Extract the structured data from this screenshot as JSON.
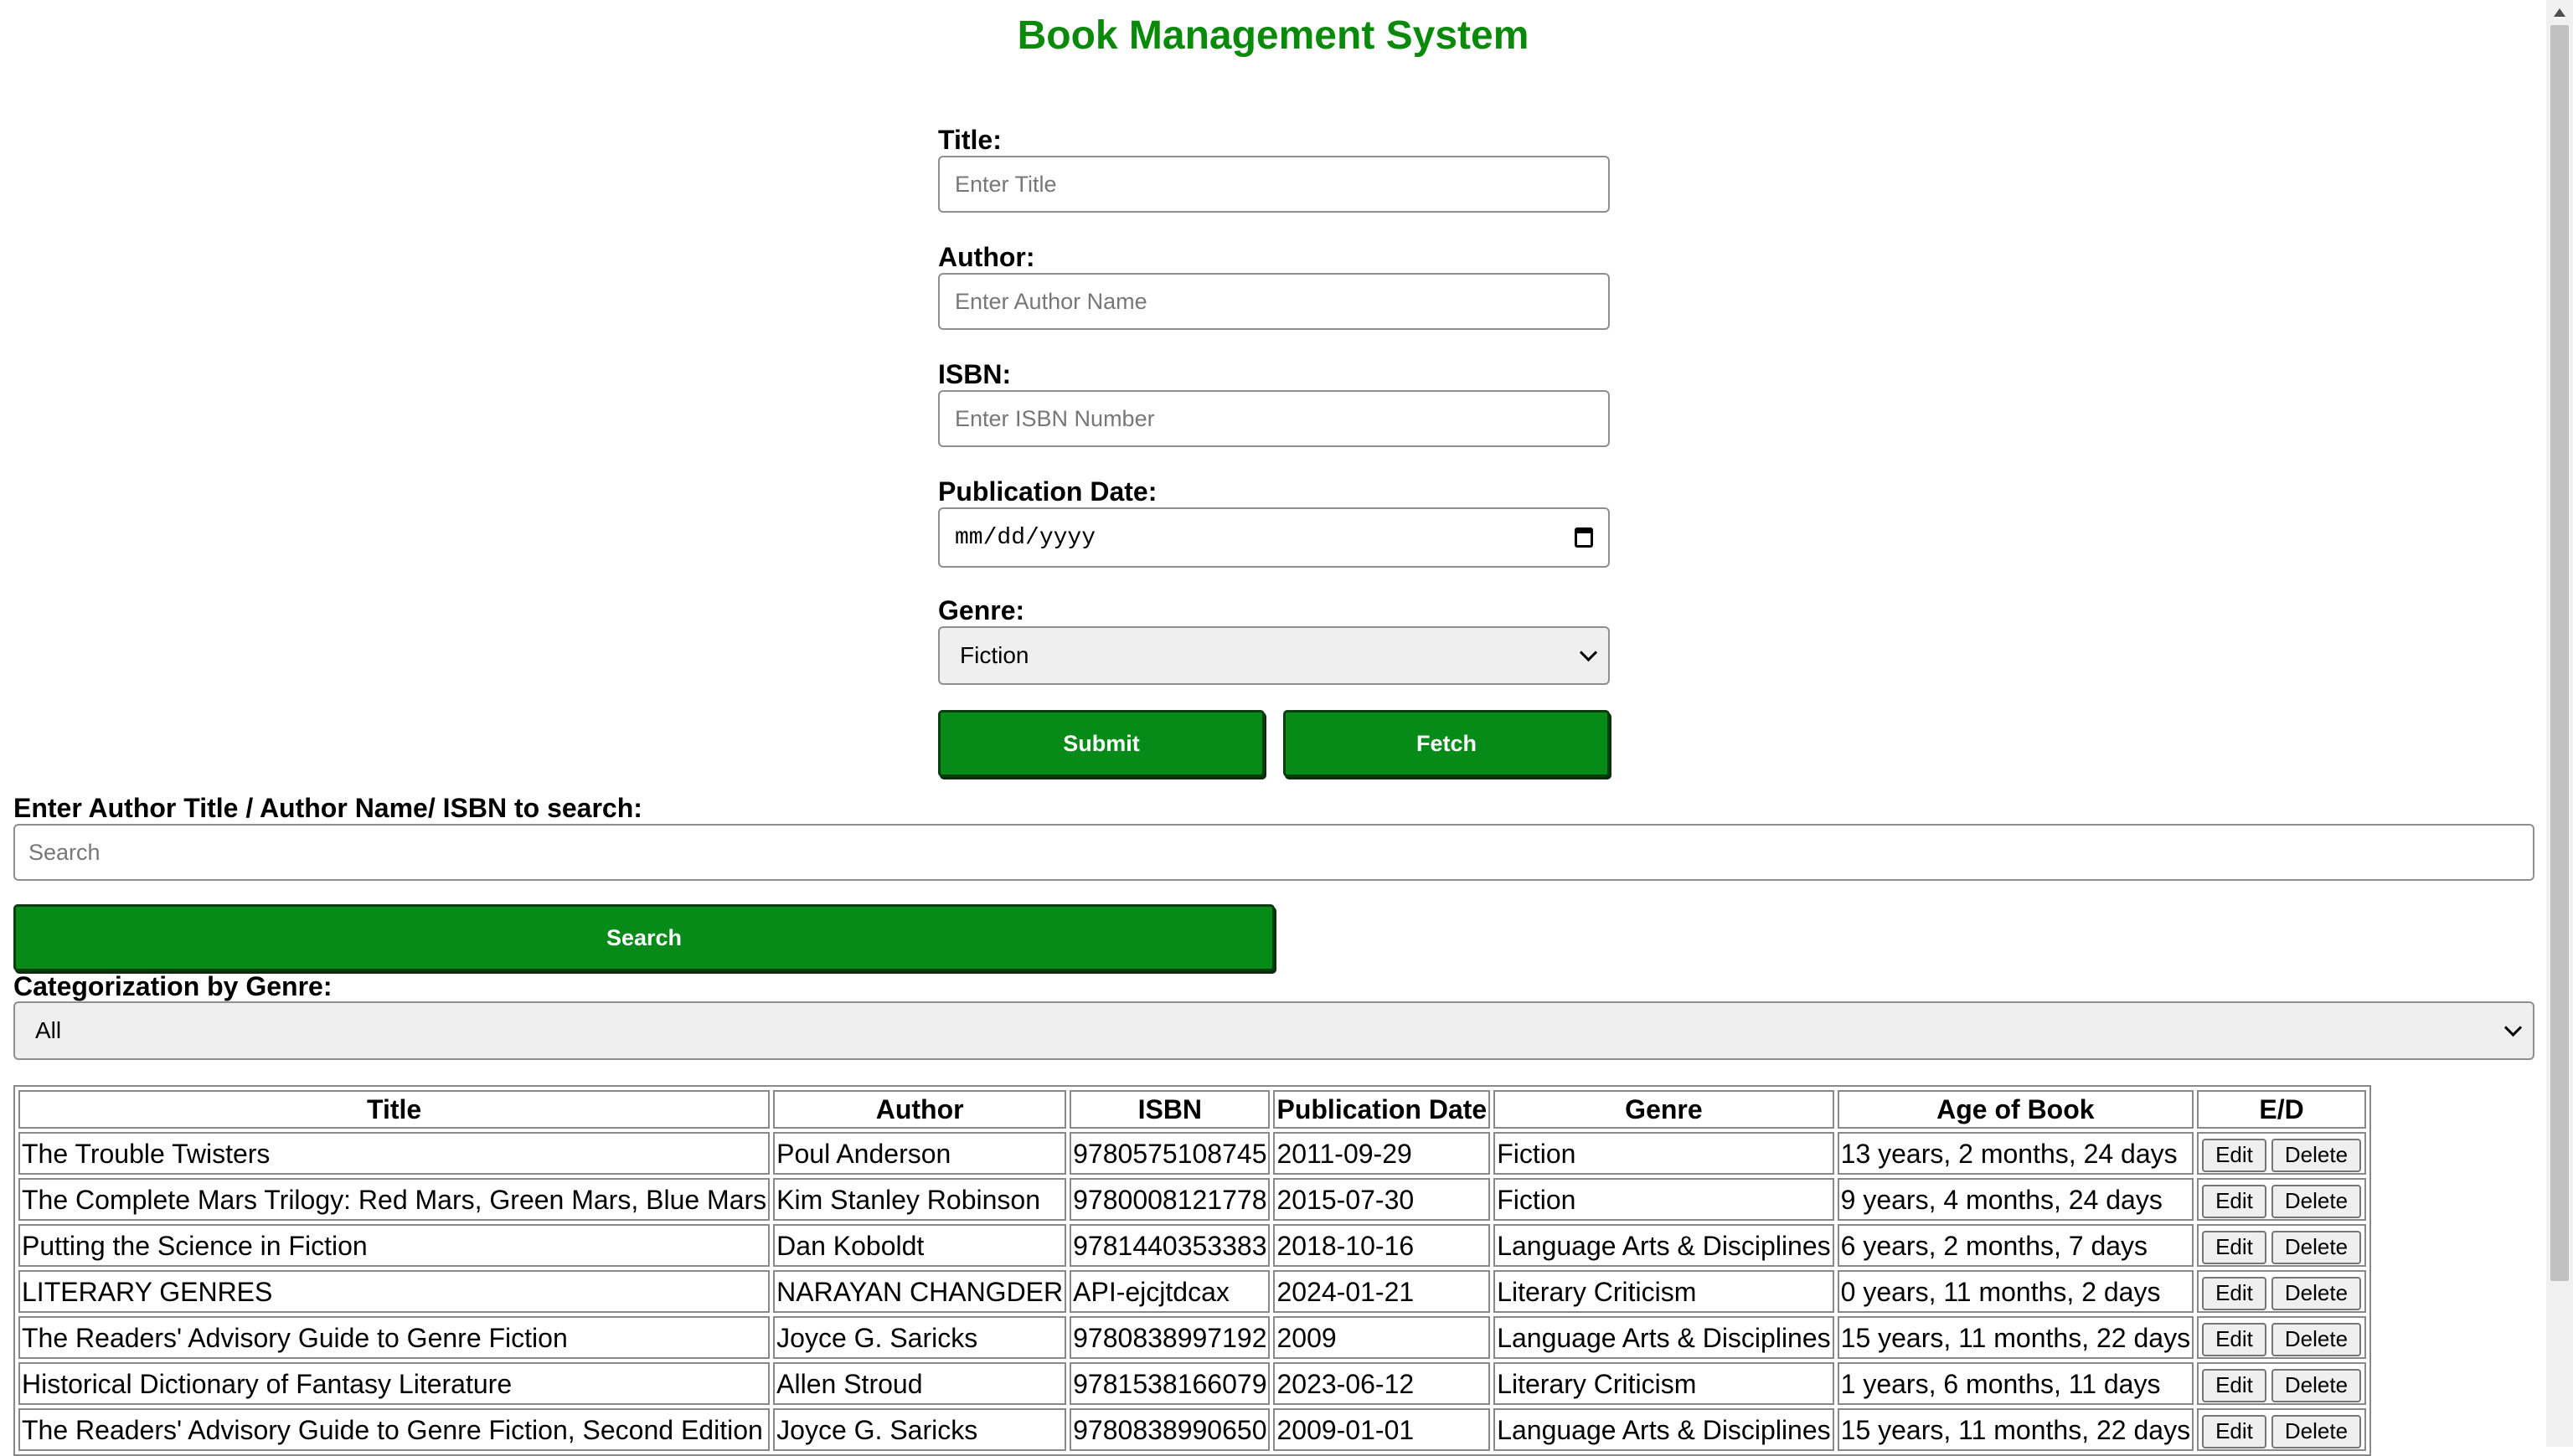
{
  "app": {
    "title": "Book Management System"
  },
  "form": {
    "title_label": "Title:",
    "title_placeholder": "Enter Title",
    "author_label": "Author:",
    "author_placeholder": "Enter Author Name",
    "isbn_label": "ISBN:",
    "isbn_placeholder": "Enter ISBN Number",
    "date_label": "Publication Date:",
    "date_placeholder": "mm/dd/yyyy",
    "genre_label": "Genre:",
    "genre_selected": "Fiction",
    "submit_label": "Submit",
    "fetch_label": "Fetch"
  },
  "search": {
    "label": "Enter Author Title / Author Name/ ISBN to search:",
    "placeholder": "Search",
    "button_label": "Search"
  },
  "filter": {
    "label": "Categorization by Genre:",
    "selected": "All"
  },
  "table": {
    "headers": [
      "Title",
      "Author",
      "ISBN",
      "Publication Date",
      "Genre",
      "Age of Book",
      "E/D"
    ],
    "edit_label": "Edit",
    "delete_label": "Delete",
    "rows": [
      {
        "title": "The Trouble Twisters",
        "author": "Poul Anderson",
        "isbn": "9780575108745",
        "date": "2011-09-29",
        "genre": "Fiction",
        "age": "13 years, 2 months, 24 days"
      },
      {
        "title": "The Complete Mars Trilogy: Red Mars, Green Mars, Blue Mars",
        "author": "Kim Stanley Robinson",
        "isbn": "9780008121778",
        "date": "2015-07-30",
        "genre": "Fiction",
        "age": "9 years, 4 months, 24 days"
      },
      {
        "title": "Putting the Science in Fiction",
        "author": "Dan Koboldt",
        "isbn": "9781440353383",
        "date": "2018-10-16",
        "genre": "Language Arts & Disciplines",
        "age": "6 years, 2 months, 7 days"
      },
      {
        "title": "LITERARY GENRES",
        "author": "NARAYAN CHANGDER",
        "isbn": "API-ejcjtdcax",
        "date": "2024-01-21",
        "genre": "Literary Criticism",
        "age": "0 years, 11 months, 2 days"
      },
      {
        "title": "The Readers' Advisory Guide to Genre Fiction",
        "author": "Joyce G. Saricks",
        "isbn": "9780838997192",
        "date": "2009",
        "genre": "Language Arts & Disciplines",
        "age": "15 years, 11 months, 22 days"
      },
      {
        "title": "Historical Dictionary of Fantasy Literature",
        "author": "Allen Stroud",
        "isbn": "9781538166079",
        "date": "2023-06-12",
        "genre": "Literary Criticism",
        "age": "1 years, 6 months, 11 days"
      },
      {
        "title": "The Readers' Advisory Guide to Genre Fiction, Second Edition",
        "author": "Joyce G. Saricks",
        "isbn": "9780838990650",
        "date": "2009-01-01",
        "genre": "Language Arts & Disciplines",
        "age": "15 years, 11 months, 22 days"
      }
    ]
  }
}
